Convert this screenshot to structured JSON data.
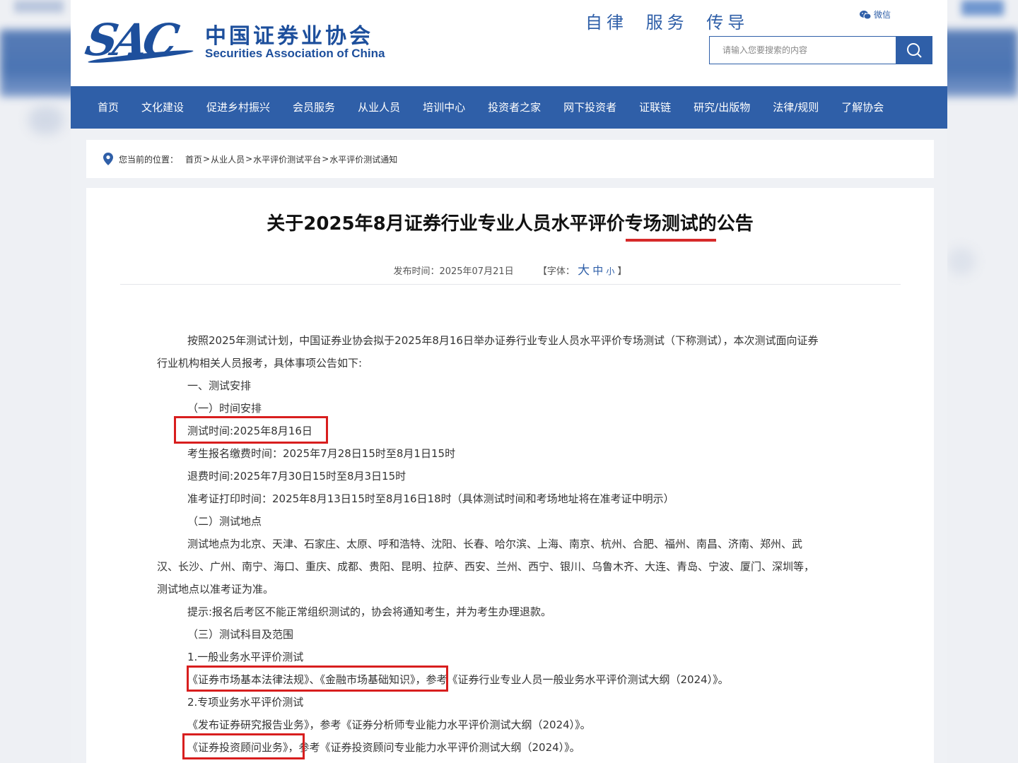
{
  "header": {
    "logo_mark": "SAC",
    "logo_cn": "中国证券业协会",
    "logo_en": "Securities Association of China",
    "slogan": "自律 服务 传导",
    "wechat_label": "微信",
    "search_placeholder": "请输入您要搜索的内容"
  },
  "nav": [
    "首页",
    "文化建设",
    "促进乡村振兴",
    "会员服务",
    "从业人员",
    "培训中心",
    "投资者之家",
    "网下投资者",
    "证联链",
    "研究/出版物",
    "法律/规则",
    "了解协会"
  ],
  "breadcrumb": {
    "label": "您当前的位置：",
    "items": [
      "首页",
      "从业人员",
      "水平评价测试平台",
      "水平评价测试通知"
    ],
    "sep": ">"
  },
  "article": {
    "title": "关于2025年8月证券行业专业人员水平评价专场测试的公告",
    "publish": "发布时间：2025年07月21日",
    "font_open": "【字体：",
    "font_large": "大",
    "font_medium": "中",
    "font_small": "小",
    "font_close": "】",
    "lines": [
      "按照2025年测试计划，中国证券业协会拟于2025年8月16日举办证券行业专业人员水平评价专场测试（下称测试），本次测试面向证券",
      "行业机构相关人员报考，具体事项公告如下:",
      "一、测试安排",
      "（一）时间安排",
      "测试时间:2025年8月16日",
      "考生报名缴费时间：2025年7月28日15时至8月1日15时",
      "退费时间:2025年7月30日15时至8月3日15时",
      "准考证打印时间：2025年8月13日15时至8月16日18时（具体测试时间和考场地址将在准考证中明示）",
      "（二）测试地点",
      "测试地点为北京、天津、石家庄、太原、呼和浩特、沈阳、长春、哈尔滨、上海、南京、杭州、合肥、福州、南昌、济南、郑州、武",
      "汉、长沙、广州、南宁、海口、重庆、成都、贵阳、昆明、拉萨、西安、兰州、西宁、银川、乌鲁木齐、大连、青岛、宁波、厦门、深圳等，",
      "测试地点以准考证为准。",
      "提示:报名后考区不能正常组织测试的，协会将通知考生，并为考生办理退款。",
      "（三）测试科目及范围",
      "1.一般业务水平评价测试",
      "《证券市场基本法律法规》、《金融市场基础知识》，参考《证券行业专业人员一般业务水平评价测试大纲（2024）》。",
      "2.专项业务水平评价测试",
      "《发布证券研究报告业务》，参考《证券分析师专业能力水平评价测试大纲（2024）》。",
      "《证券投资顾问业务》，参考《证券投资顾问专业能力水平评价测试大纲（2024）》。"
    ]
  },
  "colors": {
    "brand_blue": "#2f5fa8",
    "highlight_red": "#d81e1e"
  }
}
